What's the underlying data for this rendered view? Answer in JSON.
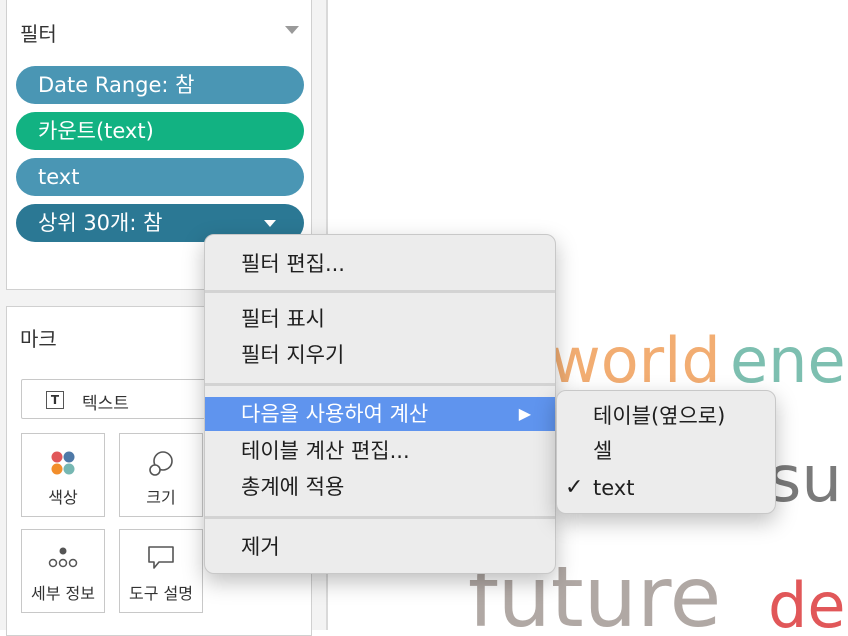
{
  "filters": {
    "title": "필터",
    "pills": [
      {
        "label": "Date Range: 참",
        "color": "#4a96b4"
      },
      {
        "label": "카운트(text)",
        "color": "#12b282"
      },
      {
        "label": "text",
        "color": "#4a96b4"
      },
      {
        "label": "상위 30개: 참",
        "color": "#2b7894"
      }
    ]
  },
  "marks": {
    "title": "마크",
    "type_label": "텍스트",
    "buttons": {
      "color": "색상",
      "size": "크기",
      "detail": "세부 정보",
      "tooltip": "도구 설명"
    },
    "t_glyph": "T"
  },
  "canvas": {
    "words": [
      {
        "text": "world",
        "color": "#f2ad72"
      },
      {
        "text": "ene",
        "color": "#7dbfb0"
      },
      {
        "text": "su",
        "color": "#7a7a7a"
      },
      {
        "text": "future",
        "color": "#b0a8a4"
      },
      {
        "text": "de",
        "color": "#e15759"
      }
    ]
  },
  "context_menu": {
    "edit_filter": "필터 편집...",
    "show_filter": "필터 표시",
    "clear_filter": "필터 지우기",
    "compute_using": "다음을 사용하여 계산",
    "submenu_arrow": "▶",
    "edit_table_calc": "테이블 계산 편집...",
    "apply_to_totals": "총계에 적용",
    "remove": "제거"
  },
  "submenu": {
    "table_across": "테이블(옆으로)",
    "cell": "셀",
    "text": "text",
    "checked": "text",
    "check_glyph": "✓"
  }
}
